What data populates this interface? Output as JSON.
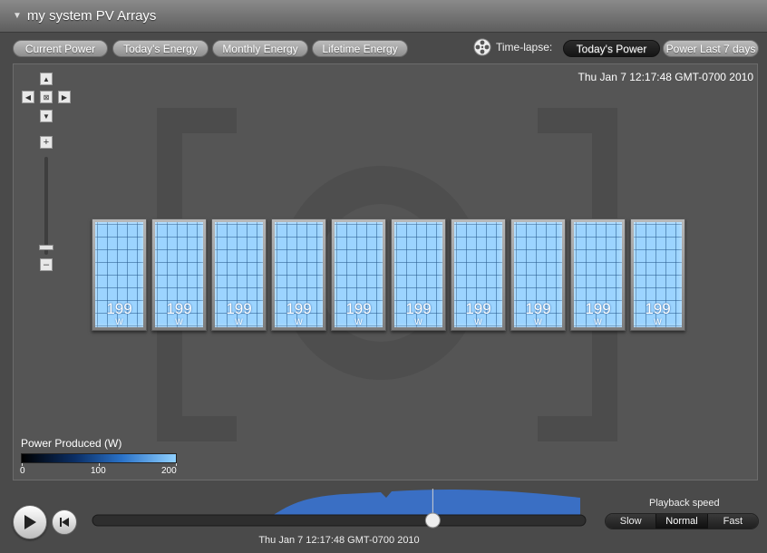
{
  "window": {
    "title": "my system PV Arrays"
  },
  "view_tabs": [
    {
      "label": "Current Power",
      "selected": true
    },
    {
      "label": "Today's Energy",
      "selected": false
    },
    {
      "label": "Monthly Energy",
      "selected": false
    },
    {
      "label": "Lifetime Energy",
      "selected": false
    }
  ],
  "timelapse": {
    "label": "Time-lapse:",
    "options": [
      {
        "label": "Today's Power",
        "selected": true
      },
      {
        "label": "Power Last 7 days",
        "selected": false
      }
    ]
  },
  "viewport": {
    "timestamp": "Thu Jan 7 12:17:48 GMT-0700 2010",
    "zoom_level": 0.1
  },
  "panels": [
    {
      "value": "199",
      "unit": "W"
    },
    {
      "value": "199",
      "unit": "W"
    },
    {
      "value": "199",
      "unit": "W"
    },
    {
      "value": "199",
      "unit": "W"
    },
    {
      "value": "199",
      "unit": "W"
    },
    {
      "value": "199",
      "unit": "W"
    },
    {
      "value": "199",
      "unit": "W"
    },
    {
      "value": "199",
      "unit": "W"
    },
    {
      "value": "199",
      "unit": "W"
    },
    {
      "value": "199",
      "unit": "W"
    }
  ],
  "legend": {
    "title": "Power Produced (W)",
    "ticks": [
      "0",
      "100",
      "200"
    ],
    "colors": [
      "#000000",
      "#0b2f66",
      "#2a72c8",
      "#8fd0ff"
    ]
  },
  "playback": {
    "timestamp": "Thu Jan 7 12:17:48 GMT-0700 2010",
    "position": 0.69,
    "speed_label": "Playback speed",
    "speeds": [
      {
        "label": "Slow",
        "selected": false
      },
      {
        "label": "Normal",
        "selected": true
      },
      {
        "label": "Fast",
        "selected": false
      }
    ],
    "profile_color": "#3a6fc4"
  }
}
